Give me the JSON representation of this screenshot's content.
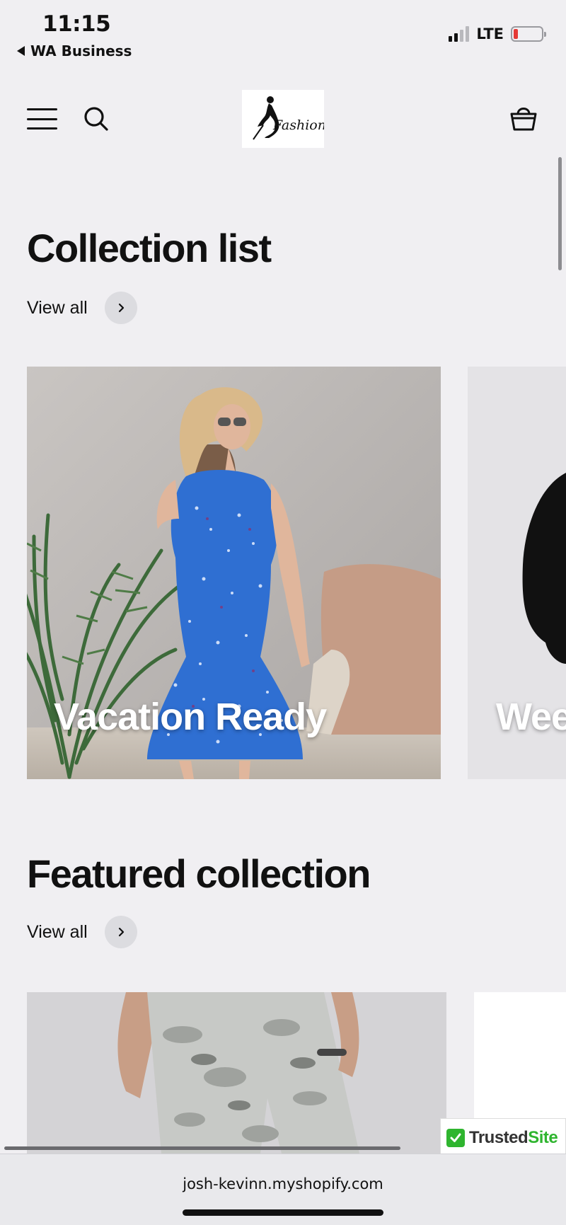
{
  "status_bar": {
    "time": "11:15",
    "back_app": "WA Business",
    "network": "LTE",
    "battery_level": 0.12
  },
  "header": {
    "logo_text": "Fashion",
    "menu_icon": "hamburger-menu-icon",
    "search_icon": "search-icon",
    "cart_icon": "cart-icon"
  },
  "collection_list": {
    "title": "Collection list",
    "view_all": "View all",
    "cards": [
      {
        "label": "Vacation Ready"
      },
      {
        "label": "Wee"
      }
    ]
  },
  "featured_collection": {
    "title": "Featured collection",
    "view_all": "View all"
  },
  "trusted_badge": {
    "part1": "Trusted",
    "part2": "Site"
  },
  "browser": {
    "url": "josh-kevinn.myshopify.com"
  },
  "colors": {
    "accent_green": "#2fb52f",
    "battery_red": "#e53935",
    "background": "#f0eff2"
  }
}
